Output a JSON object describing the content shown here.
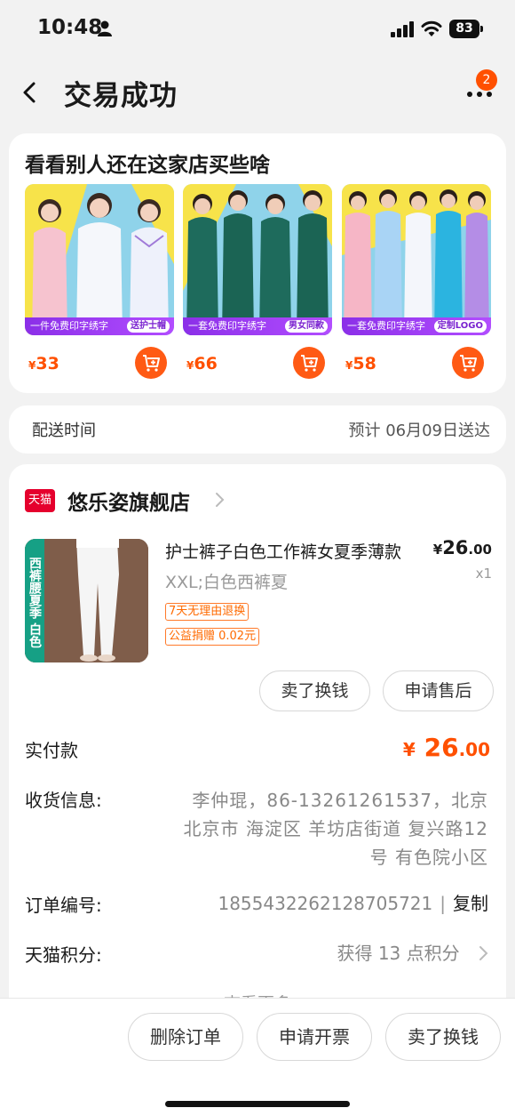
{
  "status_bar": {
    "time": "10:48",
    "battery": "83"
  },
  "nav": {
    "title": "交易成功",
    "badge": "2"
  },
  "recommend": {
    "title": "看看别人还在这家店买些啥",
    "items": [
      {
        "banner": "一件免费印字绣字",
        "tag": "送护士帽",
        "currency": "¥",
        "price": "33"
      },
      {
        "banner": "一套免费印字绣字",
        "tag": "男女同款",
        "currency": "¥",
        "price": "66"
      },
      {
        "banner": "一套免费印字绣字",
        "tag": "定制LOGO",
        "currency": "¥",
        "price": "58"
      }
    ]
  },
  "delivery": {
    "label": "配送时间",
    "value": "预计 06月09日送达"
  },
  "shop": {
    "logo_text": "天猫",
    "name": "悠乐姿旗舰店"
  },
  "product": {
    "side_tag": "西裤腰夏季 白色",
    "title": "护士裤子白色工作裤女夏季薄款",
    "sku": "XXL;白色西裤夏",
    "tag_return": "7天无理由退换",
    "tag_charity": "公益捐赠 0.02元",
    "price_currency": "¥",
    "price_int": "26",
    "price_dec": ".00",
    "qty": "x1",
    "btn_sell": "卖了换钱",
    "btn_aftersale": "申请售后"
  },
  "summary": {
    "paid_label": "实付款",
    "paid_currency": "¥",
    "paid_int": "26",
    "paid_dec": ".00",
    "address_label": "收货信息:",
    "address": "李仲琨，86-13261261537，北京 北京市 海淀区 羊坊店街道 复兴路12号 有色院小区",
    "order_label": "订单编号:",
    "order_no": "1855432262128705721",
    "order_sep": "|",
    "copy": "复制",
    "points_label": "天猫积分:",
    "points": "获得 13 点积分",
    "view_more": "查看更多"
  },
  "bottom_bar": {
    "delete": "删除订单",
    "invoice": "申请开票",
    "sell": "卖了换钱"
  },
  "colors": {
    "accent": "#ff5000",
    "tmall_red": "#e5002d",
    "purple_banner": "#8b2fe8",
    "side_tag_green": "#16a085"
  }
}
